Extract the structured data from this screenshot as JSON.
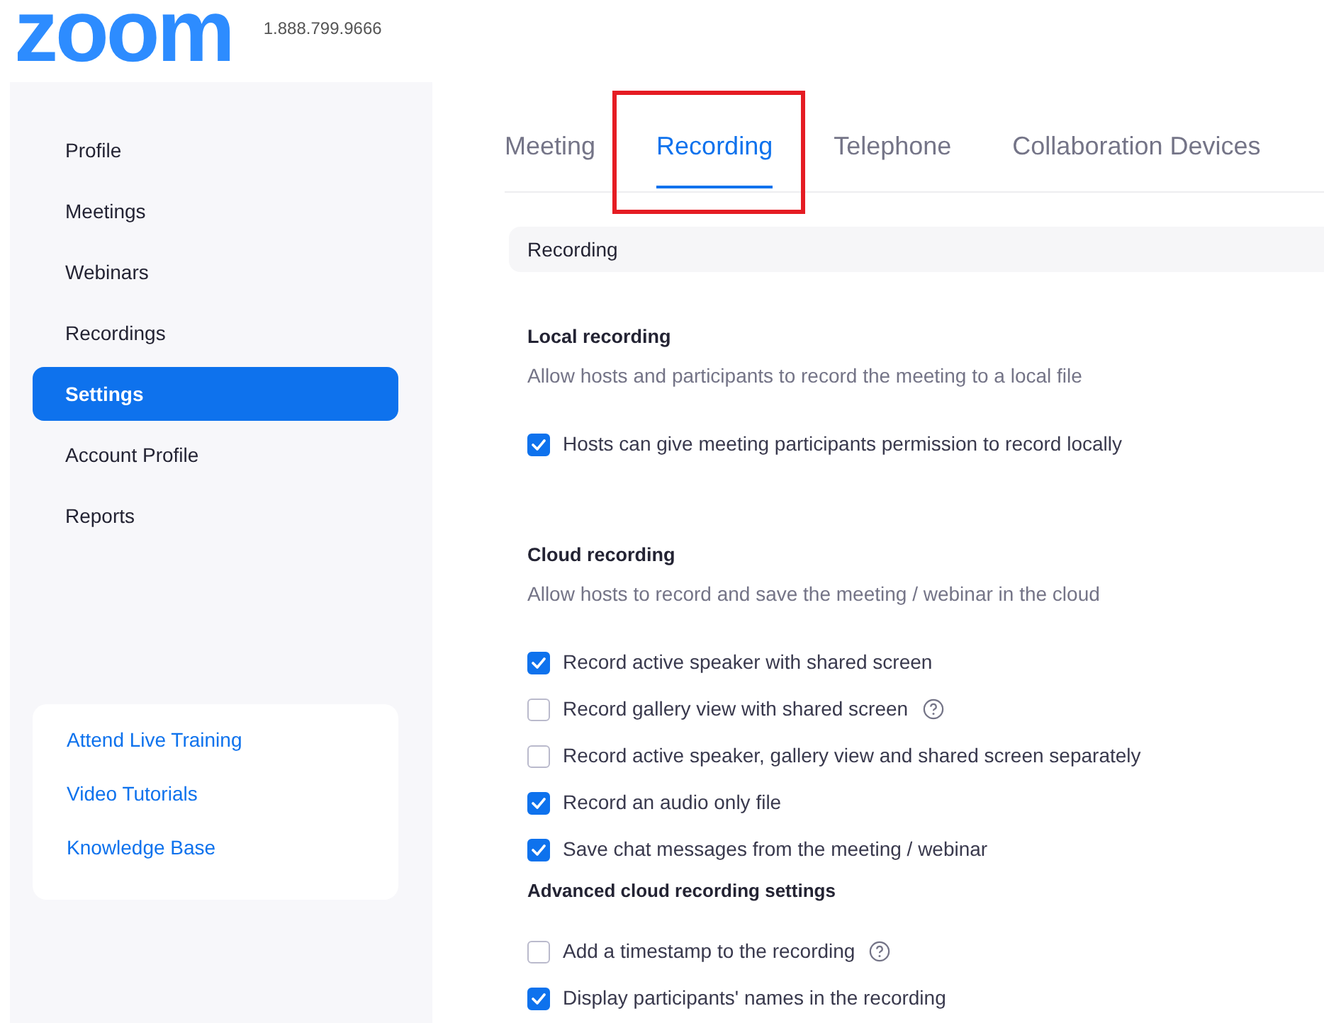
{
  "header": {
    "logo": "zoom",
    "phone": "1.888.799.9666"
  },
  "sidebar": {
    "items": [
      {
        "label": "Profile",
        "selected": false
      },
      {
        "label": "Meetings",
        "selected": false
      },
      {
        "label": "Webinars",
        "selected": false
      },
      {
        "label": "Recordings",
        "selected": false
      },
      {
        "label": "Settings",
        "selected": true
      },
      {
        "label": "Account Profile",
        "selected": false
      },
      {
        "label": "Reports",
        "selected": false
      }
    ],
    "links": [
      "Attend Live Training",
      "Video Tutorials",
      "Knowledge Base"
    ]
  },
  "tabs": [
    {
      "label": "Meeting",
      "selected": false,
      "highlighted": false
    },
    {
      "label": "Recording",
      "selected": true,
      "highlighted": true
    },
    {
      "label": "Telephone",
      "selected": false,
      "highlighted": false
    },
    {
      "label": "Collaboration Devices",
      "selected": false,
      "highlighted": false
    }
  ],
  "section_header": "Recording",
  "blocks": [
    {
      "kind": "heading",
      "text": "Local recording"
    },
    {
      "kind": "description",
      "text": "Allow hosts and participants to record the meeting to a local file"
    },
    {
      "kind": "checkbox",
      "text": "Hosts can give meeting participants permission to record locally",
      "checked": true,
      "help": false
    },
    {
      "kind": "spacer"
    },
    {
      "kind": "heading",
      "text": "Cloud recording"
    },
    {
      "kind": "description",
      "text": "Allow hosts to record and save the meeting / webinar in the cloud"
    },
    {
      "kind": "checkbox",
      "text": "Record active speaker with shared screen",
      "checked": true,
      "help": false
    },
    {
      "kind": "checkbox",
      "text": "Record gallery view with shared screen",
      "checked": false,
      "help": true
    },
    {
      "kind": "checkbox",
      "text": "Record active speaker, gallery view and shared screen separately",
      "checked": false,
      "help": false
    },
    {
      "kind": "checkbox",
      "text": "Record an audio only file",
      "checked": true,
      "help": false
    },
    {
      "kind": "checkbox",
      "text": "Save chat messages from the meeting / webinar",
      "checked": true,
      "help": false
    },
    {
      "kind": "subheading",
      "text": "Advanced cloud recording settings"
    },
    {
      "kind": "checkbox",
      "text": "Add a timestamp to the recording",
      "checked": false,
      "help": true
    },
    {
      "kind": "checkbox",
      "text": "Display participants' names in the recording",
      "checked": true,
      "help": false
    }
  ]
}
